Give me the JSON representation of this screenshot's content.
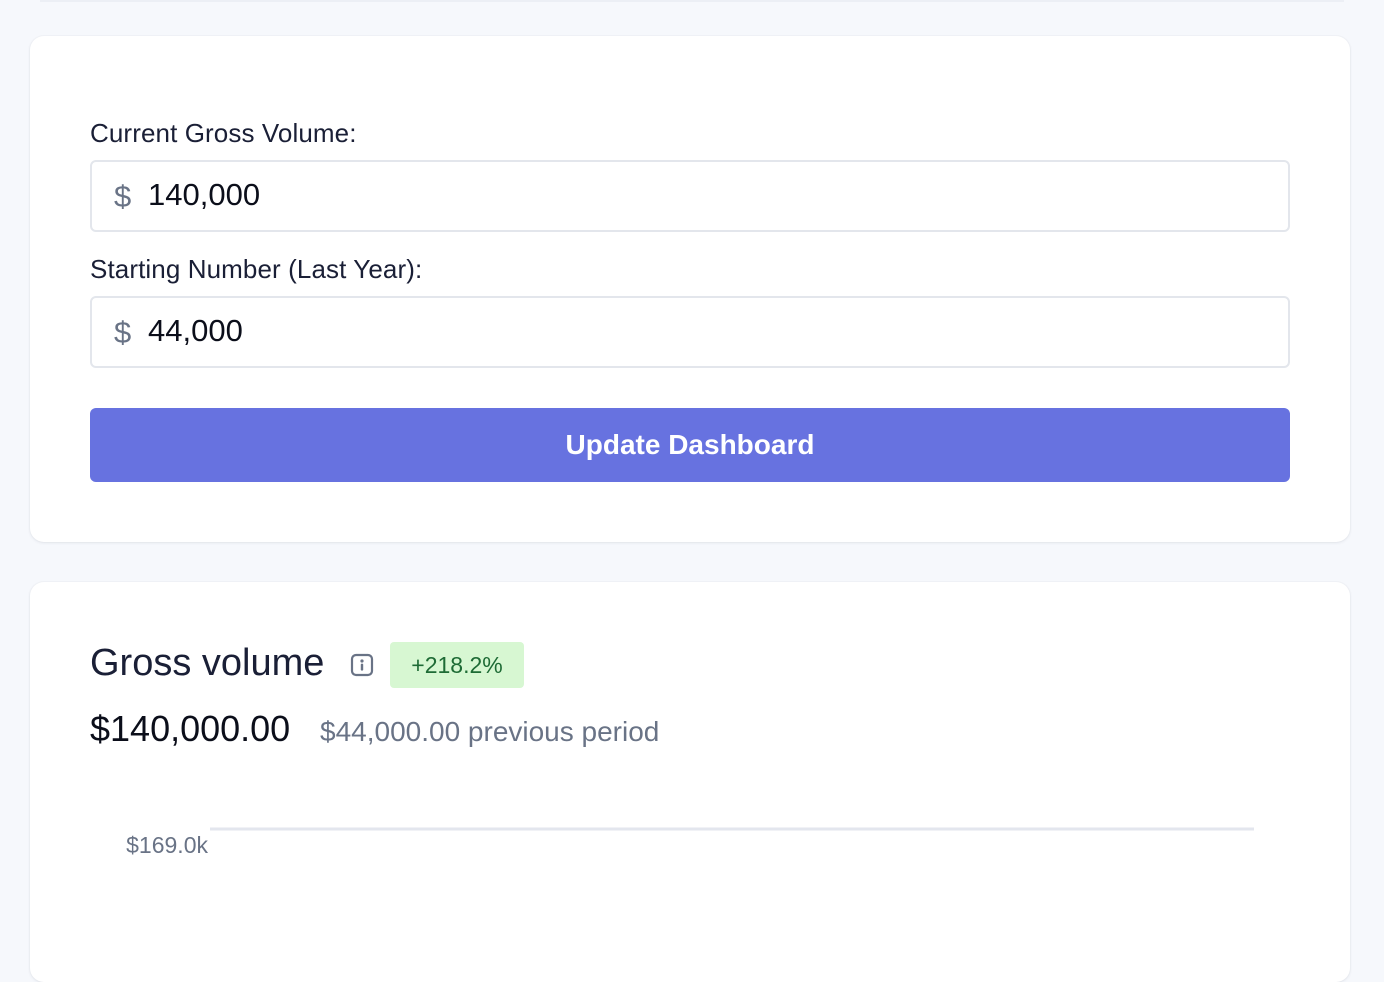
{
  "form": {
    "gross_volume_label": "Current Gross Volume:",
    "gross_volume_currency": "$",
    "gross_volume_value": "140,000",
    "starting_number_label": "Starting Number (Last Year):",
    "starting_number_currency": "$",
    "starting_number_value": "44,000",
    "update_button_label": "Update Dashboard"
  },
  "summary": {
    "title": "Gross volume",
    "info_icon": "info-icon",
    "change_badge": "+218.2%",
    "current_value": "$140,000.00",
    "previous_value": "$44,000.00",
    "previous_suffix": "previous period"
  },
  "chart_data": {
    "type": "line",
    "y_ticks": [
      "$169.0k"
    ],
    "y_tick_values": [
      169000
    ],
    "ylim": [
      0,
      169000
    ],
    "series": [],
    "grid": true
  },
  "colors": {
    "accent": "#6772e0",
    "badge_bg": "#d7f7d2",
    "badge_text": "#1e6b35",
    "gridline": "#e3e6ee",
    "muted_text": "#697386"
  }
}
